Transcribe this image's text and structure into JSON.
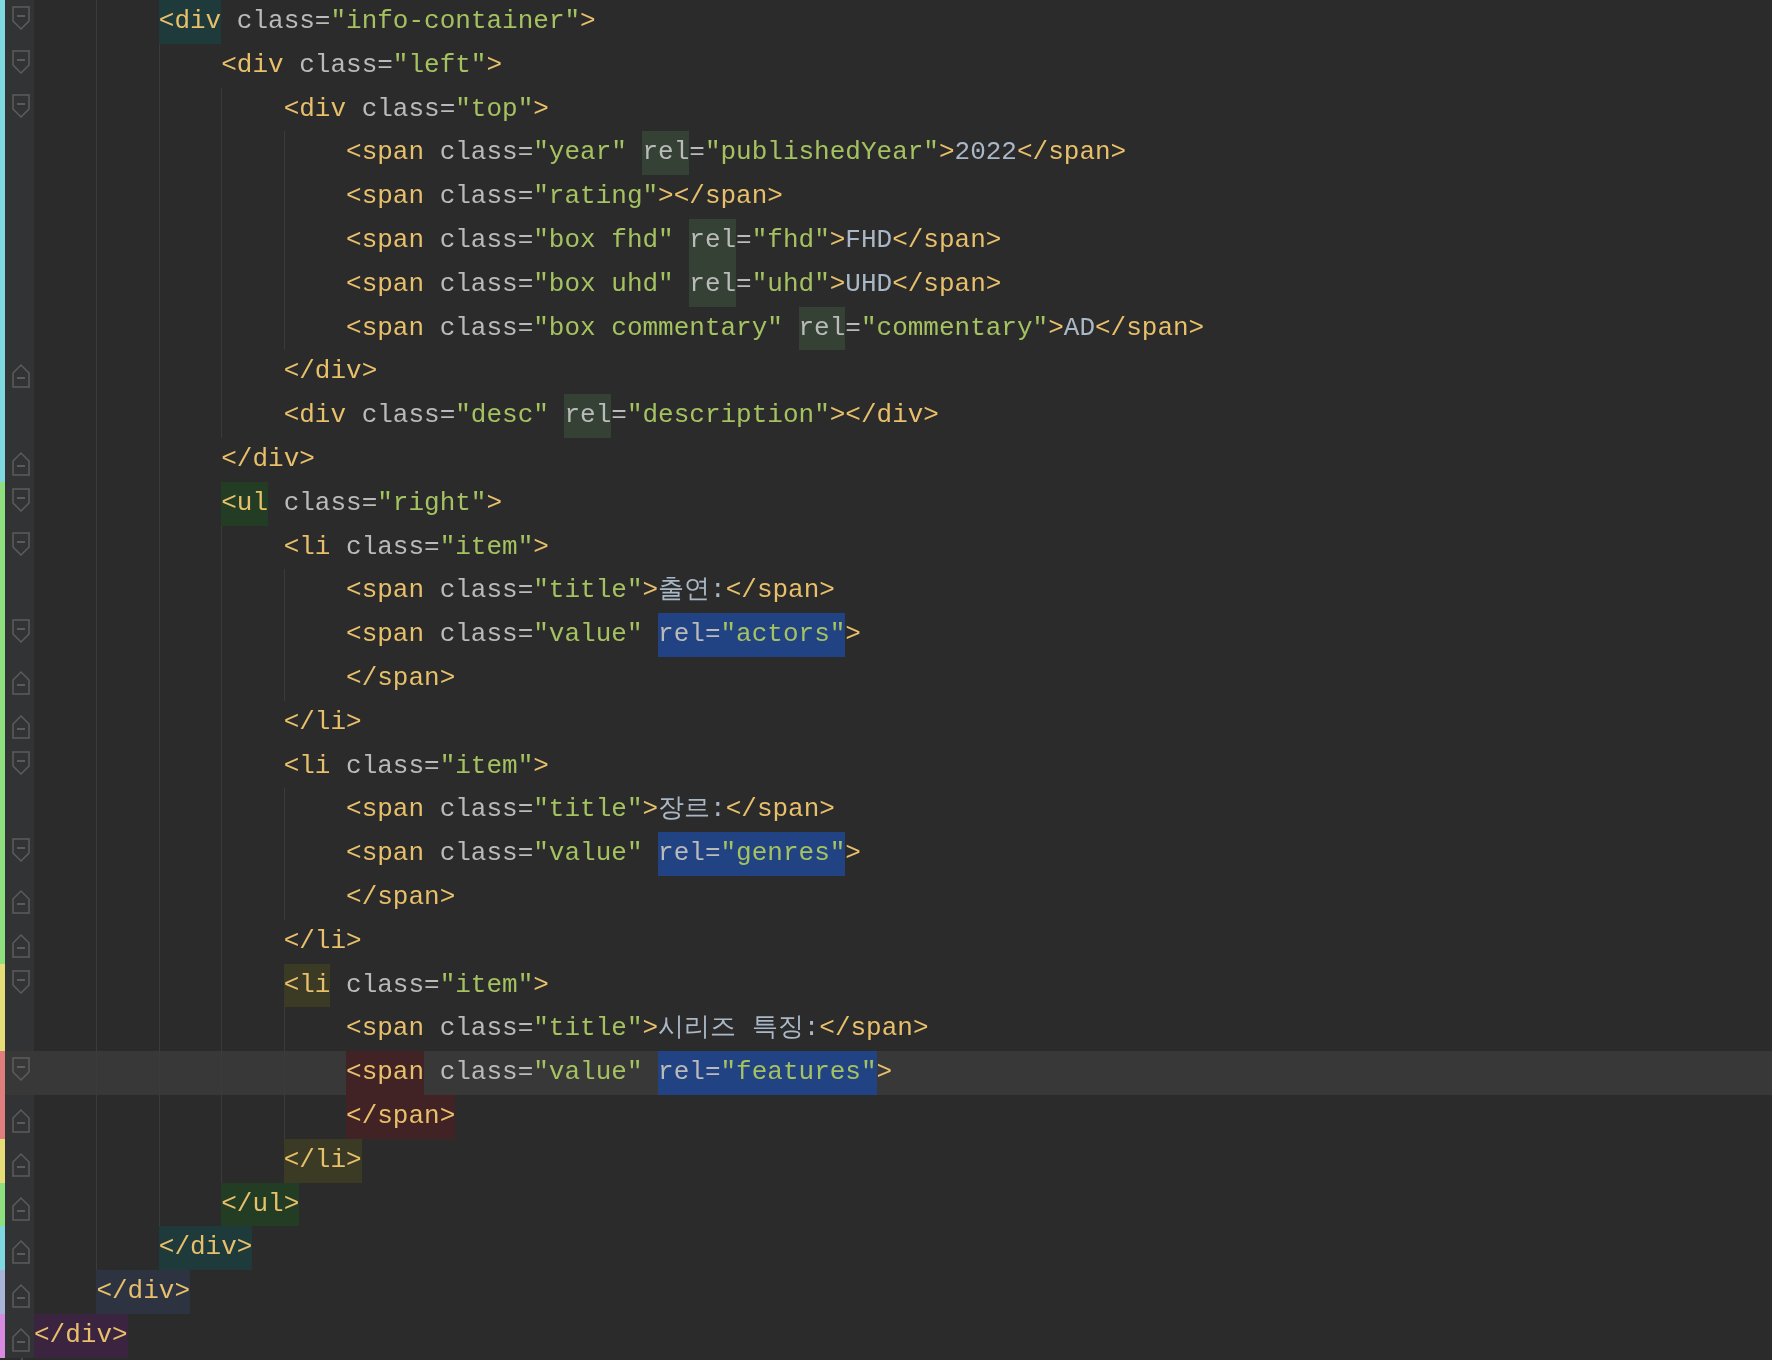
{
  "editor": {
    "lines": [
      {
        "children": [
          {
            "children": [
              {
                "kind": "open",
                "color": "#7fd8e0",
                "selected": false,
                "tokens": [
                  {
                    "kind": "tag",
                    "text": "<div",
                    "color": "#1f3a3b"
                  },
                  {
                    "kind": "attr",
                    "text": " class="
                  },
                  {
                    "kind": "value",
                    "text": "\"info-container\""
                  },
                  {
                    "kind": "tag",
                    "text": ">"
                  }
                ],
                "children": [
                  {
                    "kind": "open",
                    "color": "#7fd8e0",
                    "selected": false,
                    "tokens": [
                      {
                        "kind": "tag",
                        "text": "<div"
                      },
                      {
                        "kind": "attr",
                        "text": " class="
                      },
                      {
                        "kind": "value",
                        "text": "\"left\""
                      },
                      {
                        "kind": "tag",
                        "text": ">"
                      }
                    ],
                    "children": [
                      {
                        "kind": "open",
                        "color": "#7fd8e0",
                        "selected": false,
                        "tokens": [
                          {
                            "kind": "tag",
                            "text": "<div"
                          },
                          {
                            "kind": "attr",
                            "text": " class="
                          },
                          {
                            "kind": "value",
                            "text": "\"top\""
                          },
                          {
                            "kind": "tag",
                            "text": ">"
                          }
                        ],
                        "children": [
                          {
                            "kind": "plain",
                            "color": "#7fd8e0",
                            "selected": false,
                            "tokens": [
                              {
                                "kind": "tag",
                                "text": "<span"
                              },
                              {
                                "kind": "attr",
                                "text": " class="
                              },
                              {
                                "kind": "value",
                                "text": "\"year\" "
                              },
                              {
                                "kind": "attr",
                                "text": "rel",
                                "color": "#344134"
                              },
                              {
                                "kind": "attr",
                                "text": "="
                              },
                              {
                                "kind": "value",
                                "text": "\"publishedYear\""
                              },
                              {
                                "kind": "tag",
                                "text": ">"
                              },
                              {
                                "kind": "text",
                                "text": "2022"
                              },
                              {
                                "kind": "tag",
                                "text": "</span>"
                              }
                            ]
                          },
                          {
                            "kind": "plain",
                            "color": "#7fd8e0",
                            "selected": false,
                            "tokens": [
                              {
                                "kind": "tag",
                                "text": "<span"
                              },
                              {
                                "kind": "attr",
                                "text": " class="
                              },
                              {
                                "kind": "value",
                                "text": "\"rating\""
                              },
                              {
                                "kind": "tag",
                                "text": "></span>"
                              }
                            ]
                          },
                          {
                            "kind": "plain",
                            "color": "#7fd8e0",
                            "selected": false,
                            "tokens": [
                              {
                                "kind": "tag",
                                "text": "<span"
                              },
                              {
                                "kind": "attr",
                                "text": " class="
                              },
                              {
                                "kind": "value",
                                "text": "\"box fhd\" "
                              },
                              {
                                "kind": "attr",
                                "text": "rel",
                                "color": "#344134"
                              },
                              {
                                "kind": "attr",
                                "text": "="
                              },
                              {
                                "kind": "value",
                                "text": "\"fhd\""
                              },
                              {
                                "kind": "tag",
                                "text": ">"
                              },
                              {
                                "kind": "text",
                                "text": "FHD"
                              },
                              {
                                "kind": "tag",
                                "text": "</span>"
                              }
                            ]
                          },
                          {
                            "kind": "plain",
                            "color": "#7fd8e0",
                            "selected": false,
                            "tokens": [
                              {
                                "kind": "tag",
                                "text": "<span"
                              },
                              {
                                "kind": "attr",
                                "text": " class="
                              },
                              {
                                "kind": "value",
                                "text": "\"box uhd\" "
                              },
                              {
                                "kind": "attr",
                                "text": "rel",
                                "color": "#344134"
                              },
                              {
                                "kind": "attr",
                                "text": "="
                              },
                              {
                                "kind": "value",
                                "text": "\"uhd\""
                              },
                              {
                                "kind": "tag",
                                "text": ">"
                              },
                              {
                                "kind": "text",
                                "text": "UHD"
                              },
                              {
                                "kind": "tag",
                                "text": "</span>"
                              }
                            ]
                          },
                          {
                            "kind": "plain",
                            "color": "#7fd8e0",
                            "selected": false,
                            "tokens": [
                              {
                                "kind": "tag",
                                "text": "<span"
                              },
                              {
                                "kind": "attr",
                                "text": " class="
                              },
                              {
                                "kind": "value",
                                "text": "\"box commentary\" "
                              },
                              {
                                "kind": "attr",
                                "text": "rel",
                                "color": "#344134"
                              },
                              {
                                "kind": "attr",
                                "text": "="
                              },
                              {
                                "kind": "value",
                                "text": "\"commentary\""
                              },
                              {
                                "kind": "tag",
                                "text": ">"
                              },
                              {
                                "kind": "text",
                                "text": "AD"
                              },
                              {
                                "kind": "tag",
                                "text": "</span>"
                              }
                            ]
                          }
                        ]
                      },
                      {
                        "kind": "close",
                        "color": "#7fd8e0",
                        "selected": false,
                        "tokens": [
                          {
                            "kind": "tag",
                            "text": "</div>"
                          }
                        ]
                      },
                      {
                        "kind": "plain",
                        "color": "#7fd8e0",
                        "selected": false,
                        "tokens": [
                          {
                            "kind": "tag",
                            "text": "<div"
                          },
                          {
                            "kind": "attr",
                            "text": " class="
                          },
                          {
                            "kind": "value",
                            "text": "\"desc\" "
                          },
                          {
                            "kind": "attr",
                            "text": "rel",
                            "color": "#344134"
                          },
                          {
                            "kind": "attr",
                            "text": "="
                          },
                          {
                            "kind": "value",
                            "text": "\"description\""
                          },
                          {
                            "kind": "tag",
                            "text": "></div>"
                          }
                        ]
                      }
                    ]
                  },
                  {
                    "kind": "close",
                    "color": "#7fd8e0",
                    "selected": false,
                    "tokens": [
                      {
                        "kind": "tag",
                        "text": "</div>"
                      }
                    ]
                  },
                  {
                    "kind": "open",
                    "color": "#8ee07e",
                    "selected": false,
                    "tokens": [
                      {
                        "kind": "tag",
                        "text": "<ul",
                        "color": "#233d25"
                      },
                      {
                        "kind": "attr",
                        "text": " class="
                      },
                      {
                        "kind": "value",
                        "text": "\"right\""
                      },
                      {
                        "kind": "tag",
                        "text": ">"
                      }
                    ],
                    "children": [
                      {
                        "kind": "open",
                        "color": "#8ee07e",
                        "selected": false,
                        "tokens": [
                          {
                            "kind": "tag",
                            "text": "<li"
                          },
                          {
                            "kind": "attr",
                            "text": " class="
                          },
                          {
                            "kind": "value",
                            "text": "\"item\""
                          },
                          {
                            "kind": "tag",
                            "text": ">"
                          }
                        ],
                        "children": [
                          {
                            "kind": "plain",
                            "color": "#8ee07e",
                            "selected": false,
                            "tokens": [
                              {
                                "kind": "tag",
                                "text": "<span"
                              },
                              {
                                "kind": "attr",
                                "text": " class="
                              },
                              {
                                "kind": "value",
                                "text": "\"title\""
                              },
                              {
                                "kind": "tag",
                                "text": ">"
                              },
                              {
                                "kind": "text",
                                "text": "출연:"
                              },
                              {
                                "kind": "tag",
                                "text": "</span>"
                              }
                            ]
                          },
                          {
                            "kind": "open",
                            "color": "#8ee07e",
                            "selected": false,
                            "tokens": [
                              {
                                "kind": "tag",
                                "text": "<span"
                              },
                              {
                                "kind": "attr",
                                "text": " class="
                              },
                              {
                                "kind": "value",
                                "text": "\"value\" "
                              },
                              {
                                "kind": "attr",
                                "text": "rel=",
                                "color": "#214283"
                              },
                              {
                                "kind": "value",
                                "text": "\"actors\"",
                                "color": "#214283"
                              },
                              {
                                "kind": "tag",
                                "text": ">"
                              }
                            ]
                          },
                          {
                            "kind": "close",
                            "color": "#8ee07e",
                            "selected": false,
                            "tokens": [
                              {
                                "kind": "tag",
                                "text": "</span>"
                              }
                            ]
                          }
                        ]
                      },
                      {
                        "kind": "close",
                        "color": "#8ee07e",
                        "selected": false,
                        "tokens": [
                          {
                            "kind": "tag",
                            "text": "</li>"
                          }
                        ]
                      },
                      {
                        "kind": "open",
                        "color": "#8ee07e",
                        "selected": false,
                        "tokens": [
                          {
                            "kind": "tag",
                            "text": "<li"
                          },
                          {
                            "kind": "attr",
                            "text": " class="
                          },
                          {
                            "kind": "value",
                            "text": "\"item\""
                          },
                          {
                            "kind": "tag",
                            "text": ">"
                          }
                        ],
                        "children": [
                          {
                            "kind": "plain",
                            "color": "#8ee07e",
                            "selected": false,
                            "tokens": [
                              {
                                "kind": "tag",
                                "text": "<span"
                              },
                              {
                                "kind": "attr",
                                "text": " class="
                              },
                              {
                                "kind": "value",
                                "text": "\"title\""
                              },
                              {
                                "kind": "tag",
                                "text": ">"
                              },
                              {
                                "kind": "text",
                                "text": "장르:"
                              },
                              {
                                "kind": "tag",
                                "text": "</span>"
                              }
                            ]
                          },
                          {
                            "kind": "open",
                            "color": "#8ee07e",
                            "selected": false,
                            "tokens": [
                              {
                                "kind": "tag",
                                "text": "<span"
                              },
                              {
                                "kind": "attr",
                                "text": " class="
                              },
                              {
                                "kind": "value",
                                "text": "\"value\" "
                              },
                              {
                                "kind": "attr",
                                "text": "rel=",
                                "color": "#214283"
                              },
                              {
                                "kind": "value",
                                "text": "\"genres\"",
                                "color": "#214283"
                              },
                              {
                                "kind": "tag",
                                "text": ">"
                              }
                            ]
                          },
                          {
                            "kind": "close",
                            "color": "#8ee07e",
                            "selected": false,
                            "tokens": [
                              {
                                "kind": "tag",
                                "text": "</span>"
                              }
                            ]
                          }
                        ]
                      },
                      {
                        "kind": "close",
                        "color": "#8ee07e",
                        "selected": false,
                        "tokens": [
                          {
                            "kind": "tag",
                            "text": "</li>"
                          }
                        ]
                      },
                      {
                        "kind": "open",
                        "color": "#e6dc78",
                        "selected": false,
                        "tokens": [
                          {
                            "kind": "tag",
                            "text": "<li",
                            "color": "#3b3a24"
                          },
                          {
                            "kind": "attr",
                            "text": " class="
                          },
                          {
                            "kind": "value",
                            "text": "\"item\""
                          },
                          {
                            "kind": "tag",
                            "text": ">"
                          }
                        ],
                        "children": [
                          {
                            "kind": "plain",
                            "color": "#e6dc78",
                            "selected": false,
                            "tokens": [
                              {
                                "kind": "tag",
                                "text": "<span"
                              },
                              {
                                "kind": "attr",
                                "text": " class="
                              },
                              {
                                "kind": "value",
                                "text": "\"title\""
                              },
                              {
                                "kind": "tag",
                                "text": ">"
                              },
                              {
                                "kind": "text",
                                "text": "시리즈 특징:"
                              },
                              {
                                "kind": "tag",
                                "text": "</span>"
                              }
                            ]
                          },
                          {
                            "kind": "open",
                            "color": "#e07e7e",
                            "selected": true,
                            "tokens": [
                              {
                                "kind": "tag",
                                "text": "<span",
                                "color": "#412326"
                              },
                              {
                                "kind": "attr",
                                "text": " class="
                              },
                              {
                                "kind": "value",
                                "text": "\"value\" "
                              },
                              {
                                "kind": "attr",
                                "text": "rel=",
                                "color": "#214283"
                              },
                              {
                                "kind": "value",
                                "text": "\"features\"",
                                "color": "#214283"
                              },
                              {
                                "kind": "tag",
                                "text": ">"
                              }
                            ]
                          },
                          {
                            "kind": "close",
                            "color": "#e07e7e",
                            "selected": false,
                            "tokens": [
                              {
                                "kind": "tag",
                                "text": "</span>",
                                "color": "#412326"
                              }
                            ]
                          }
                        ]
                      },
                      {
                        "kind": "close",
                        "color": "#e6dc78",
                        "selected": false,
                        "tokens": [
                          {
                            "kind": "tag",
                            "text": "</li>",
                            "color": "#3b3a24"
                          }
                        ]
                      }
                    ]
                  },
                  {
                    "kind": "close",
                    "color": "#8ee07e",
                    "selected": false,
                    "tokens": [
                      {
                        "kind": "tag",
                        "text": "</ul>",
                        "color": "#233d25"
                      }
                    ]
                  }
                ]
              },
              {
                "kind": "close",
                "color": "#7fd8e0",
                "selected": false,
                "tokens": [
                  {
                    "kind": "tag",
                    "text": "</div>",
                    "color": "#1f3a3b"
                  }
                ]
              }
            ]
          },
          {
            "kind": "close",
            "color": "#a8b4d8",
            "selected": false,
            "tokens": [
              {
                "kind": "tag",
                "text": "</div>",
                "color": "#2d3340"
              }
            ]
          }
        ]
      },
      {
        "kind": "close",
        "color": "#d88ae0",
        "selected": false,
        "tokens": [
          {
            "kind": "tag",
            "text": "</div>",
            "color": "#3a2440"
          }
        ]
      }
    ]
  }
}
